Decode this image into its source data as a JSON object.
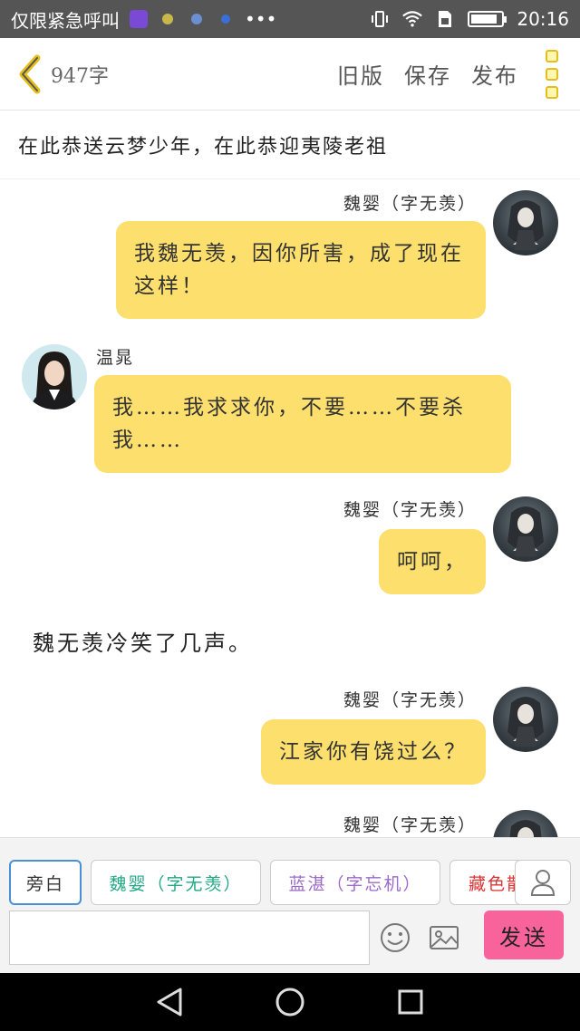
{
  "status_bar": {
    "carrier": "仅限紧急呼叫",
    "time": "20:16",
    "battery_level": 0.85
  },
  "header": {
    "word_count": "947字",
    "actions": [
      "旧版",
      "保存",
      "发布"
    ]
  },
  "title": "在此恭送云梦少年，在此恭迎夷陵老祖",
  "messages": [
    {
      "type": "right",
      "name": "魏婴（字无羡）",
      "text": "我魏无羡，因你所害，成了现在这样！"
    },
    {
      "type": "left",
      "name": "温晁",
      "text": "我……我求求你，不要……不要杀我……"
    },
    {
      "type": "right",
      "name": "魏婴（字无羡）",
      "text": "呵呵，"
    },
    {
      "type": "narration",
      "text": "魏无羡冷笑了几声。"
    },
    {
      "type": "right",
      "name": "魏婴（字无羡）",
      "text": "江家你有饶过么？"
    },
    {
      "type": "right",
      "name": "魏婴（字无羡）",
      "text": ""
    }
  ],
  "panel": {
    "characters": [
      "旁白",
      "魏婴（字无羡）",
      "蓝湛（字忘机）",
      "藏色散人"
    ],
    "input_placeholder": "",
    "send_label": "发送"
  },
  "colors": {
    "bubble": "#fddf6e",
    "send": "#f7639a",
    "accent": "#e3be1c"
  }
}
